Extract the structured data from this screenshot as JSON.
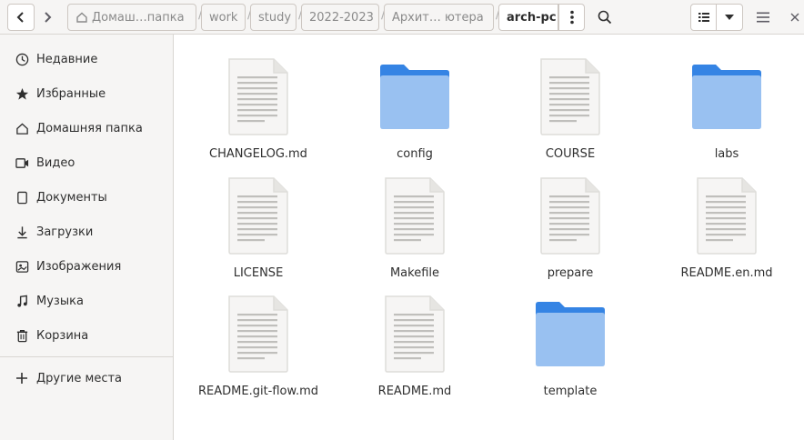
{
  "toolbar": {
    "back_icon": "go-previous-icon",
    "forward_icon": "go-next-icon",
    "menu_icon": "view-more-icon",
    "search_icon": "search-icon",
    "list_view_icon": "view-list-icon",
    "view_options_icon": "pan-down-icon",
    "main_menu_icon": "open-menu-icon",
    "close_icon": "window-close-icon"
  },
  "breadcrumbs": [
    {
      "label": "Домаш…папка"
    },
    {
      "label": "work"
    },
    {
      "label": "study"
    },
    {
      "label": "2022-2023"
    },
    {
      "label": "Архит… ютера"
    },
    {
      "label": "arch-pc"
    }
  ],
  "sidebar": {
    "items": [
      {
        "label": "Недавние",
        "icon": "clock-icon"
      },
      {
        "label": "Избранные",
        "icon": "star-icon"
      },
      {
        "label": "Домашняя папка",
        "icon": "home-icon"
      },
      {
        "label": "Видео",
        "icon": "video-icon"
      },
      {
        "label": "Документы",
        "icon": "document-icon"
      },
      {
        "label": "Загрузки",
        "icon": "download-icon"
      },
      {
        "label": "Изображения",
        "icon": "image-icon"
      },
      {
        "label": "Музыка",
        "icon": "music-icon"
      },
      {
        "label": "Корзина",
        "icon": "trash-icon"
      }
    ],
    "other_places": {
      "label": "Другие места",
      "icon": "plus-icon"
    }
  },
  "files": [
    {
      "name": "CHANGELOG.md",
      "type": "file"
    },
    {
      "name": "config",
      "type": "folder"
    },
    {
      "name": "COURSE",
      "type": "file"
    },
    {
      "name": "labs",
      "type": "folder"
    },
    {
      "name": "LICENSE",
      "type": "file"
    },
    {
      "name": "Makefile",
      "type": "file"
    },
    {
      "name": "prepare",
      "type": "file"
    },
    {
      "name": "README.en.md",
      "type": "file"
    },
    {
      "name": "README.git-flow.md",
      "type": "file"
    },
    {
      "name": "README.md",
      "type": "file"
    },
    {
      "name": "template",
      "type": "folder"
    }
  ],
  "colors": {
    "folder_top": "#3584e4",
    "folder_body": "#99c1f1",
    "file_page": "#f6f5f4",
    "file_lines": "#c0bfbc"
  }
}
